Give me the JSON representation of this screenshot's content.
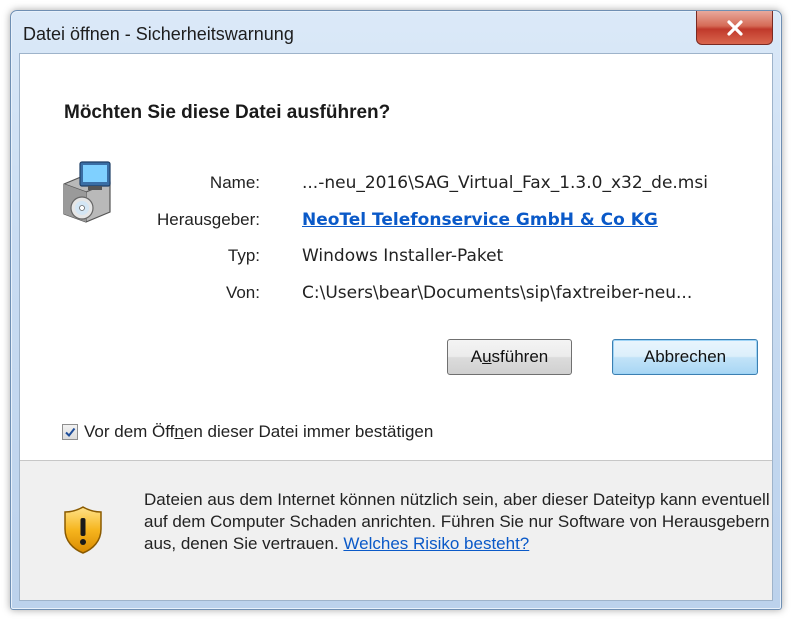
{
  "window": {
    "title": "Datei öffnen - Sicherheitswarnung",
    "close_icon": "close-icon"
  },
  "question": "Möchten Sie diese Datei ausführen?",
  "fields": {
    "name_label": "Name:",
    "name_value": "...-neu_2016\\SAG_Virtual_Fax_1.3.0_x32_de.msi",
    "publisher_label": "Herausgeber:",
    "publisher_value": "NeoTel Telefonservice GmbH & Co KG",
    "type_label": "Typ:",
    "type_value": "Windows Installer-Paket",
    "from_label": "Von:",
    "from_value": "C:\\Users\\bear\\Documents\\sip\\faxtreiber-neu..."
  },
  "buttons": {
    "run_pre": "A",
    "run_accel": "u",
    "run_post": "sführen",
    "cancel": "Abbrechen"
  },
  "checkbox": {
    "checked": true,
    "label_pre": "Vor dem Öff",
    "label_accel": "n",
    "label_post": "en dieser Datei immer bestätigen"
  },
  "warning": {
    "icon": "shield-warning-icon",
    "text": "Dateien aus dem Internet können nützlich sein, aber dieser Dateityp kann eventuell auf dem Computer Schaden anrichten. Führen Sie nur Software von Herausgebern aus, denen Sie vertrauen. ",
    "link": "Welches Risiko besteht?"
  },
  "colors": {
    "link": "#0a59c8",
    "close_button": "#c0392b",
    "default_button_border": "#3c7fb1"
  }
}
